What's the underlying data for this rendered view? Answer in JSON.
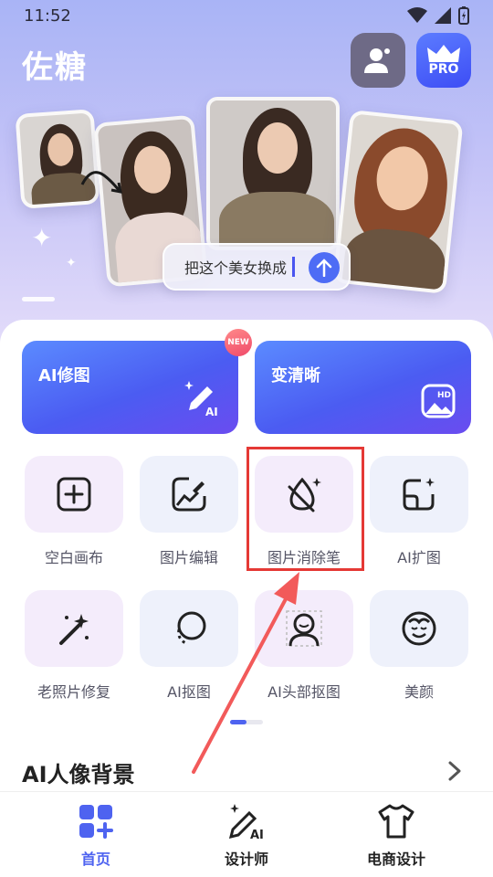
{
  "status_bar": {
    "time": "11:52"
  },
  "header": {
    "app_title": "佐糖",
    "pro_label": "PRO"
  },
  "banner": {
    "prompt_text": "把这个美女换成"
  },
  "feature_cards": [
    {
      "label": "AI修图",
      "badge": "NEW",
      "icon_text": "AI"
    },
    {
      "label": "变清晰",
      "icon_text": "HD"
    }
  ],
  "tools": [
    {
      "label": "空白画布",
      "icon": "plus-square-icon"
    },
    {
      "label": "图片编辑",
      "icon": "image-edit-icon"
    },
    {
      "label": "图片消除笔",
      "icon": "eraser-drop-icon"
    },
    {
      "label": "AI扩图",
      "icon": "expand-image-icon"
    },
    {
      "label": "老照片修复",
      "icon": "magic-wand-icon"
    },
    {
      "label": "AI抠图",
      "icon": "cutout-icon"
    },
    {
      "label": "AI头部抠图",
      "icon": "head-cutout-icon"
    },
    {
      "label": "美颜",
      "icon": "beauty-face-icon"
    }
  ],
  "section": {
    "title": "AI人像背景"
  },
  "bottom_nav": [
    {
      "label": "首页",
      "icon": "home-grid-icon",
      "active": true
    },
    {
      "label": "设计师",
      "icon": "ai-pen-icon",
      "active": false
    },
    {
      "label": "电商设计",
      "icon": "tshirt-icon",
      "active": false
    }
  ],
  "colors": {
    "accent": "#4e63f0",
    "highlight": "#e53935",
    "annotation_arrow": "#f25a5a"
  }
}
